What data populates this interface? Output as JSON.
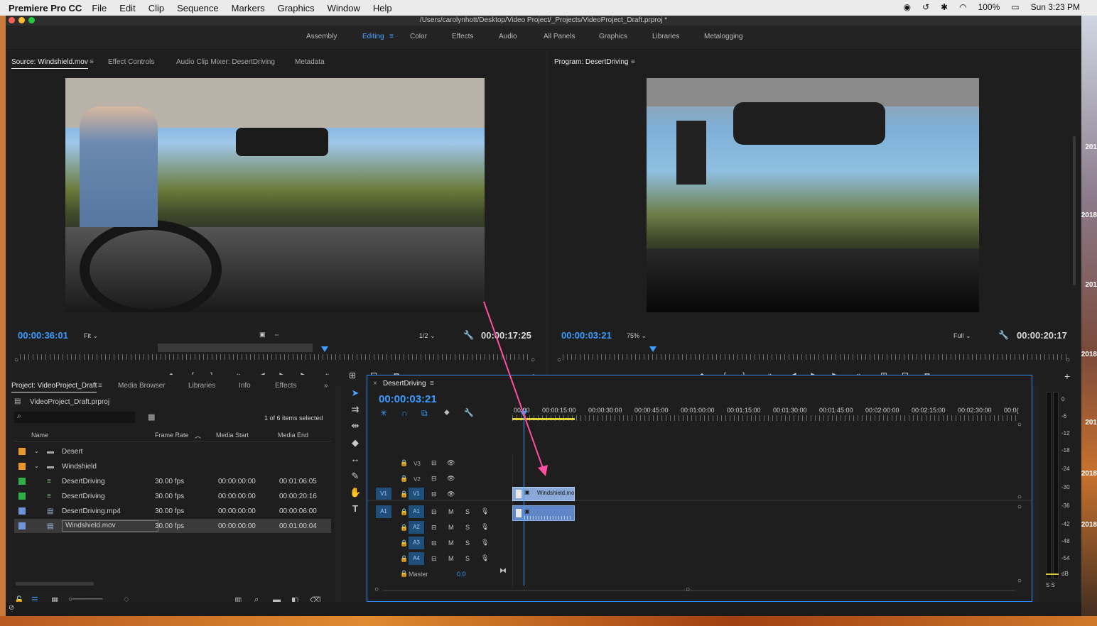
{
  "menubar": {
    "app": "Premiere Pro CC",
    "menus": [
      "File",
      "Edit",
      "Clip",
      "Sequence",
      "Markers",
      "Graphics",
      "Window",
      "Help"
    ],
    "battery": "100%",
    "clock": "Sun 3:23 PM"
  },
  "window": {
    "title": "/Users/carolynhott/Desktop/Video Project/_Projects/VideoProject_Draft.prproj *"
  },
  "workspaces": {
    "items": [
      "Assembly",
      "Editing",
      "Color",
      "Effects",
      "Audio",
      "All Panels",
      "Graphics",
      "Libraries",
      "Metalogging"
    ],
    "active": "Editing"
  },
  "source_monitor": {
    "tabs": [
      "Source: Windshield.mov",
      "Effect Controls",
      "Audio Clip Mixer: DesertDriving",
      "Metadata"
    ],
    "timecode": "00:00:36:01",
    "fit": "Fit",
    "resolution": "1/2",
    "duration": "00:00:17:25"
  },
  "program_monitor": {
    "tab": "Program: DesertDriving",
    "timecode": "00:00:03:21",
    "zoom": "75%",
    "resolution": "Full",
    "duration": "00:00:20:17"
  },
  "project_panel": {
    "tabs": [
      "Project: VideoProject_Draft",
      "Media Browser",
      "Libraries",
      "Info",
      "Effects"
    ],
    "file": "VideoProject_Draft.prproj",
    "selection_info": "1 of 6 items selected",
    "columns": [
      "Name",
      "Frame Rate",
      "Media Start",
      "Media End"
    ],
    "rows": [
      {
        "color": "#e8962e",
        "type": "bin",
        "name": "Desert",
        "fps": "",
        "start": "",
        "end": ""
      },
      {
        "color": "#e8962e",
        "type": "bin",
        "name": "Windshield",
        "fps": "",
        "start": "",
        "end": ""
      },
      {
        "color": "#2fae4a",
        "type": "seq",
        "name": "DesertDriving",
        "fps": "30.00 fps",
        "start": "00:00:00:00",
        "end": "00:01:06:05"
      },
      {
        "color": "#2fae4a",
        "type": "seq",
        "name": "DesertDriving",
        "fps": "30.00 fps",
        "start": "00:00:00:00",
        "end": "00:00:20:16"
      },
      {
        "color": "#6f95d6",
        "type": "clip",
        "name": "DesertDriving.mp4",
        "fps": "30.00 fps",
        "start": "00:00:00:00",
        "end": "00:00:06:00"
      },
      {
        "color": "#6f95d6",
        "type": "clip",
        "name": "Windshield.mov",
        "fps": "30.00 fps",
        "start": "00:00:00:00",
        "end": "00:01:00:04"
      }
    ]
  },
  "timeline": {
    "tab": "DesertDriving",
    "timecode": "00:00:03:21",
    "ruler": [
      "00:00",
      "00:00:15:00",
      "00:00:30:00",
      "00:00:45:00",
      "00:01:00:00",
      "00:01:15:00",
      "00:01:30:00",
      "00:01:45:00",
      "00:02:00:00",
      "00:02:15:00",
      "00:02:30:00",
      "00:0("
    ],
    "video_tracks": [
      "V3",
      "V2",
      "V1"
    ],
    "audio_tracks": [
      "A1",
      "A2",
      "A3",
      "A4"
    ],
    "source_v": "V1",
    "source_a": "A1",
    "master_label": "Master",
    "master_value": "0.0",
    "clip_name": "Windshield.mo",
    "track_m": "M",
    "track_s": "S"
  },
  "meter": {
    "labels": [
      "0",
      "-6",
      "-12",
      "-18",
      "-24",
      "-30",
      "-36",
      "-42",
      "-48",
      "-54",
      "dB"
    ],
    "solo": "S S"
  },
  "desktop_dates": [
    "201",
    "2018",
    "201",
    "2018",
    "201",
    "2018",
    "2018"
  ],
  "colors": {
    "accent": "#3d9cff",
    "annotation_arrow": "#ff4fa0",
    "clip_video": "#8aa9d8",
    "clip_audio": "#5f86c6"
  }
}
